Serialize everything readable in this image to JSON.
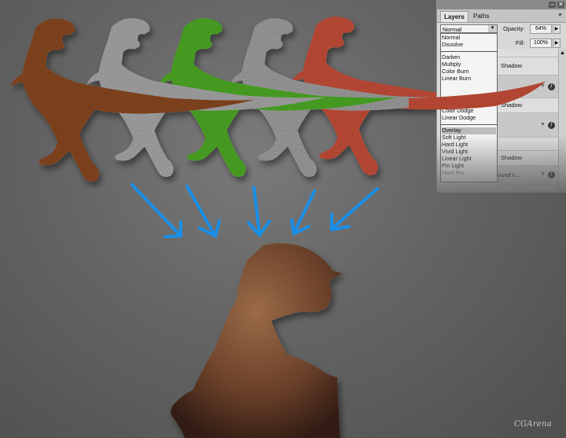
{
  "panel": {
    "tabs": [
      {
        "label": "Layers",
        "active": true
      },
      {
        "label": "Paths",
        "active": false
      }
    ],
    "window_controls": {
      "minimize": "–",
      "close": "✕"
    },
    "blend_mode_selected": "Normal",
    "opacity_label": "Opacity:",
    "opacity_value": "64%",
    "fill_label": "Fill:",
    "fill_value": "100%",
    "blend_modes": [
      {
        "label": "Normal",
        "group": 1
      },
      {
        "label": "Dissolve",
        "group": 1
      },
      {
        "label": "Darken",
        "group": 2
      },
      {
        "label": "Multiply",
        "group": 2
      },
      {
        "label": "Color Burn",
        "group": 2
      },
      {
        "label": "Linear Burn",
        "group": 2
      },
      {
        "label": "Color Dodge",
        "group": 3
      },
      {
        "label": "Linear Dodge",
        "group": 3
      },
      {
        "label": "Overlay",
        "group": 4,
        "selected": true
      },
      {
        "label": "Soft Light",
        "group": 4
      },
      {
        "label": "Hard Light",
        "group": 4
      },
      {
        "label": "Vivid Light",
        "group": 4
      },
      {
        "label": "Linear Light",
        "group": 4
      },
      {
        "label": "Pin Light",
        "group": 4
      },
      {
        "label": "Hard Mix",
        "group": 4
      }
    ],
    "layers": [
      {
        "name": "Shadow"
      },
      {
        "name": "Shadow"
      },
      {
        "name": "Shadow"
      },
      {
        "name": "ound c..."
      }
    ]
  },
  "illustration": {
    "source_dinos": [
      {
        "name": "brown",
        "color": "#8a4a22"
      },
      {
        "name": "gray",
        "color": "#a8a8a8"
      },
      {
        "name": "green",
        "color": "#4ea82a"
      },
      {
        "name": "gray2",
        "color": "#9c9c9c"
      },
      {
        "name": "red",
        "color": "#c8503a"
      }
    ],
    "arrow_color": "#1a8fe8",
    "result_dino_color": "#8a5a3c"
  },
  "credit": "CGArena"
}
